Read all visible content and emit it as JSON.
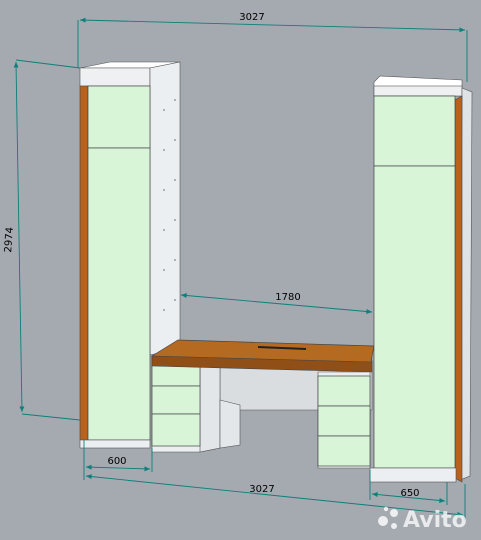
{
  "dimensions": {
    "total_width_top": "3027",
    "height": "2974",
    "desk_span": "1780",
    "left_depth": "600",
    "total_width_bottom": "3027",
    "right_depth": "650"
  },
  "watermark": {
    "brand": "Avito"
  },
  "colors": {
    "background": "#a4aab0",
    "panel_green": "#d8f5d8",
    "edge_wood": "#b8621e",
    "carcass_white": "#eceff1",
    "desk_top": "#b56a22",
    "dimension_line": "#0e7f7a"
  }
}
